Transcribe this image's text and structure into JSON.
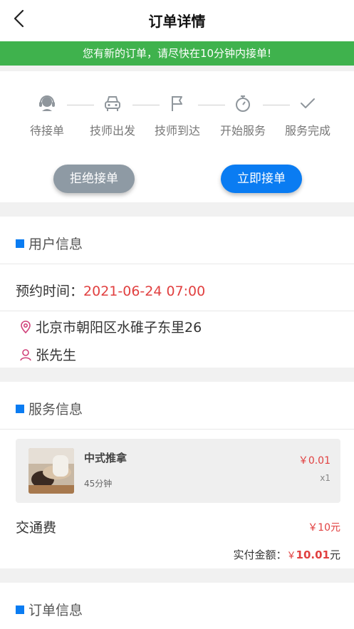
{
  "header": {
    "title": "订单详情",
    "back_icon": "chevron-left-icon"
  },
  "banner": {
    "text": "您有新的订单，请尽快在10分钟内接单!",
    "color": "#3fb24d"
  },
  "steps": [
    {
      "label": "待接单",
      "icon": "headset-icon"
    },
    {
      "label": "技师出发",
      "icon": "car-icon"
    },
    {
      "label": "技师到达",
      "icon": "flag-icon"
    },
    {
      "label": "开始服务",
      "icon": "stopwatch-icon"
    },
    {
      "label": "服务完成",
      "icon": "check-icon"
    }
  ],
  "actions": {
    "reject_label": "拒绝接单",
    "accept_label": "立即接单"
  },
  "user_info": {
    "heading": "用户信息",
    "appointment_label": "预约时间：",
    "appointment_value": "2021-06-24 07:00",
    "address": "北京市朝阳区水碓子东里26",
    "name": "张先生"
  },
  "service_info": {
    "heading": "服务信息",
    "item": {
      "name": "中式推拿",
      "duration": "45分钟",
      "price": "￥0.01",
      "qty": "x1"
    },
    "transport_label": "交通费",
    "transport_value": "￥10元",
    "total_label": "实付金额：",
    "total_currency": "￥",
    "total_amount": "10.01",
    "total_unit": "元"
  },
  "order_info": {
    "heading": "订单信息"
  },
  "colors": {
    "accent": "#0a7cf2",
    "price_red": "#e14040",
    "reject_gray": "#8e9aa4"
  }
}
